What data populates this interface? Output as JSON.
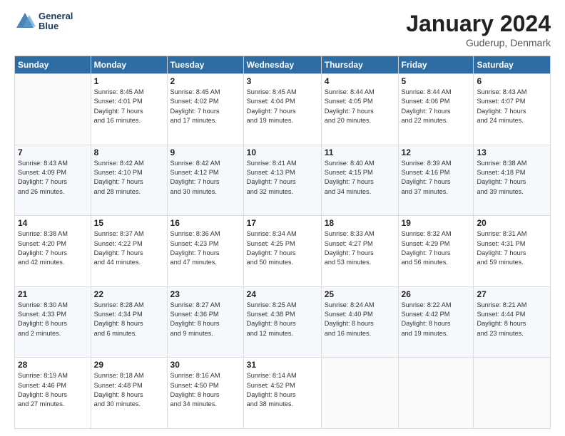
{
  "header": {
    "logo_line1": "General",
    "logo_line2": "Blue",
    "month_title": "January 2024",
    "location": "Guderup, Denmark"
  },
  "weekdays": [
    "Sunday",
    "Monday",
    "Tuesday",
    "Wednesday",
    "Thursday",
    "Friday",
    "Saturday"
  ],
  "weeks": [
    [
      {
        "day": "",
        "info": ""
      },
      {
        "day": "1",
        "info": "Sunrise: 8:45 AM\nSunset: 4:01 PM\nDaylight: 7 hours\nand 16 minutes."
      },
      {
        "day": "2",
        "info": "Sunrise: 8:45 AM\nSunset: 4:02 PM\nDaylight: 7 hours\nand 17 minutes."
      },
      {
        "day": "3",
        "info": "Sunrise: 8:45 AM\nSunset: 4:04 PM\nDaylight: 7 hours\nand 19 minutes."
      },
      {
        "day": "4",
        "info": "Sunrise: 8:44 AM\nSunset: 4:05 PM\nDaylight: 7 hours\nand 20 minutes."
      },
      {
        "day": "5",
        "info": "Sunrise: 8:44 AM\nSunset: 4:06 PM\nDaylight: 7 hours\nand 22 minutes."
      },
      {
        "day": "6",
        "info": "Sunrise: 8:43 AM\nSunset: 4:07 PM\nDaylight: 7 hours\nand 24 minutes."
      }
    ],
    [
      {
        "day": "7",
        "info": "Sunrise: 8:43 AM\nSunset: 4:09 PM\nDaylight: 7 hours\nand 26 minutes."
      },
      {
        "day": "8",
        "info": "Sunrise: 8:42 AM\nSunset: 4:10 PM\nDaylight: 7 hours\nand 28 minutes."
      },
      {
        "day": "9",
        "info": "Sunrise: 8:42 AM\nSunset: 4:12 PM\nDaylight: 7 hours\nand 30 minutes."
      },
      {
        "day": "10",
        "info": "Sunrise: 8:41 AM\nSunset: 4:13 PM\nDaylight: 7 hours\nand 32 minutes."
      },
      {
        "day": "11",
        "info": "Sunrise: 8:40 AM\nSunset: 4:15 PM\nDaylight: 7 hours\nand 34 minutes."
      },
      {
        "day": "12",
        "info": "Sunrise: 8:39 AM\nSunset: 4:16 PM\nDaylight: 7 hours\nand 37 minutes."
      },
      {
        "day": "13",
        "info": "Sunrise: 8:38 AM\nSunset: 4:18 PM\nDaylight: 7 hours\nand 39 minutes."
      }
    ],
    [
      {
        "day": "14",
        "info": "Sunrise: 8:38 AM\nSunset: 4:20 PM\nDaylight: 7 hours\nand 42 minutes."
      },
      {
        "day": "15",
        "info": "Sunrise: 8:37 AM\nSunset: 4:22 PM\nDaylight: 7 hours\nand 44 minutes."
      },
      {
        "day": "16",
        "info": "Sunrise: 8:36 AM\nSunset: 4:23 PM\nDaylight: 7 hours\nand 47 minutes."
      },
      {
        "day": "17",
        "info": "Sunrise: 8:34 AM\nSunset: 4:25 PM\nDaylight: 7 hours\nand 50 minutes."
      },
      {
        "day": "18",
        "info": "Sunrise: 8:33 AM\nSunset: 4:27 PM\nDaylight: 7 hours\nand 53 minutes."
      },
      {
        "day": "19",
        "info": "Sunrise: 8:32 AM\nSunset: 4:29 PM\nDaylight: 7 hours\nand 56 minutes."
      },
      {
        "day": "20",
        "info": "Sunrise: 8:31 AM\nSunset: 4:31 PM\nDaylight: 7 hours\nand 59 minutes."
      }
    ],
    [
      {
        "day": "21",
        "info": "Sunrise: 8:30 AM\nSunset: 4:33 PM\nDaylight: 8 hours\nand 2 minutes."
      },
      {
        "day": "22",
        "info": "Sunrise: 8:28 AM\nSunset: 4:34 PM\nDaylight: 8 hours\nand 6 minutes."
      },
      {
        "day": "23",
        "info": "Sunrise: 8:27 AM\nSunset: 4:36 PM\nDaylight: 8 hours\nand 9 minutes."
      },
      {
        "day": "24",
        "info": "Sunrise: 8:25 AM\nSunset: 4:38 PM\nDaylight: 8 hours\nand 12 minutes."
      },
      {
        "day": "25",
        "info": "Sunrise: 8:24 AM\nSunset: 4:40 PM\nDaylight: 8 hours\nand 16 minutes."
      },
      {
        "day": "26",
        "info": "Sunrise: 8:22 AM\nSunset: 4:42 PM\nDaylight: 8 hours\nand 19 minutes."
      },
      {
        "day": "27",
        "info": "Sunrise: 8:21 AM\nSunset: 4:44 PM\nDaylight: 8 hours\nand 23 minutes."
      }
    ],
    [
      {
        "day": "28",
        "info": "Sunrise: 8:19 AM\nSunset: 4:46 PM\nDaylight: 8 hours\nand 27 minutes."
      },
      {
        "day": "29",
        "info": "Sunrise: 8:18 AM\nSunset: 4:48 PM\nDaylight: 8 hours\nand 30 minutes."
      },
      {
        "day": "30",
        "info": "Sunrise: 8:16 AM\nSunset: 4:50 PM\nDaylight: 8 hours\nand 34 minutes."
      },
      {
        "day": "31",
        "info": "Sunrise: 8:14 AM\nSunset: 4:52 PM\nDaylight: 8 hours\nand 38 minutes."
      },
      {
        "day": "",
        "info": ""
      },
      {
        "day": "",
        "info": ""
      },
      {
        "day": "",
        "info": ""
      }
    ]
  ]
}
